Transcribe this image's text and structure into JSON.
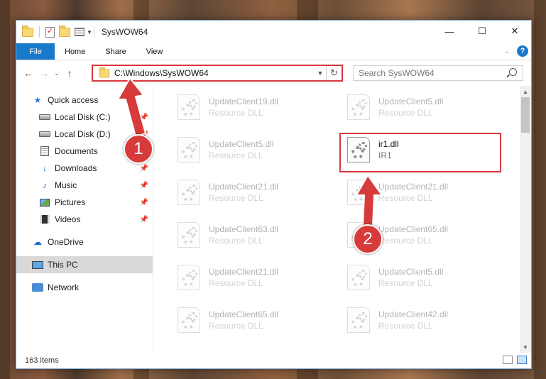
{
  "window": {
    "title": "SysWOW64",
    "minimize": "—",
    "maximize": "☐",
    "close": "✕"
  },
  "ribbon": {
    "tabs": [
      "File",
      "Home",
      "Share",
      "View"
    ]
  },
  "nav": {
    "back": "←",
    "forward": "→",
    "recent": "⌄",
    "up": "↑",
    "address": "C:\\Windows\\SysWOW64",
    "search_placeholder": "Search SysWOW64"
  },
  "sidebar": {
    "quick_access": "Quick access",
    "items": [
      {
        "label": "Local Disk (C:)"
      },
      {
        "label": "Local Disk (D:)"
      },
      {
        "label": "Documents"
      },
      {
        "label": "Downloads"
      },
      {
        "label": "Music"
      },
      {
        "label": "Pictures"
      },
      {
        "label": "Videos"
      }
    ],
    "onedrive": "OneDrive",
    "this_pc": "This PC",
    "network": "Network"
  },
  "files": [
    {
      "name": "UpdateClient19.dll",
      "desc": "Resource DLL"
    },
    {
      "name": "UpdateClient5.dll",
      "desc": "Resource DLL"
    },
    {
      "name": "UpdateClient5.dll",
      "desc": "Resource DLL"
    },
    {
      "name": "ir1.dll",
      "desc": "IR1"
    },
    {
      "name": "UpdateClient21.dll",
      "desc": "Resource DLL"
    },
    {
      "name": "UpdateClient21.dll",
      "desc": "Resource DLL"
    },
    {
      "name": "UpdateClient63.dll",
      "desc": "Resource DLL"
    },
    {
      "name": "UpdateClient65.dll",
      "desc": "Resource DLL"
    },
    {
      "name": "UpdateClient21.dll",
      "desc": "Resource DLL"
    },
    {
      "name": "UpdateClient5.dll",
      "desc": "Resource DLL"
    },
    {
      "name": "UpdateClient65.dll",
      "desc": "Resource DLL"
    },
    {
      "name": "UpdateClient42.dll",
      "desc": "Resource DLL"
    }
  ],
  "status": {
    "count": "163 items"
  },
  "annotations": {
    "step1": "1",
    "step2": "2",
    "color": "#d73a3a"
  }
}
